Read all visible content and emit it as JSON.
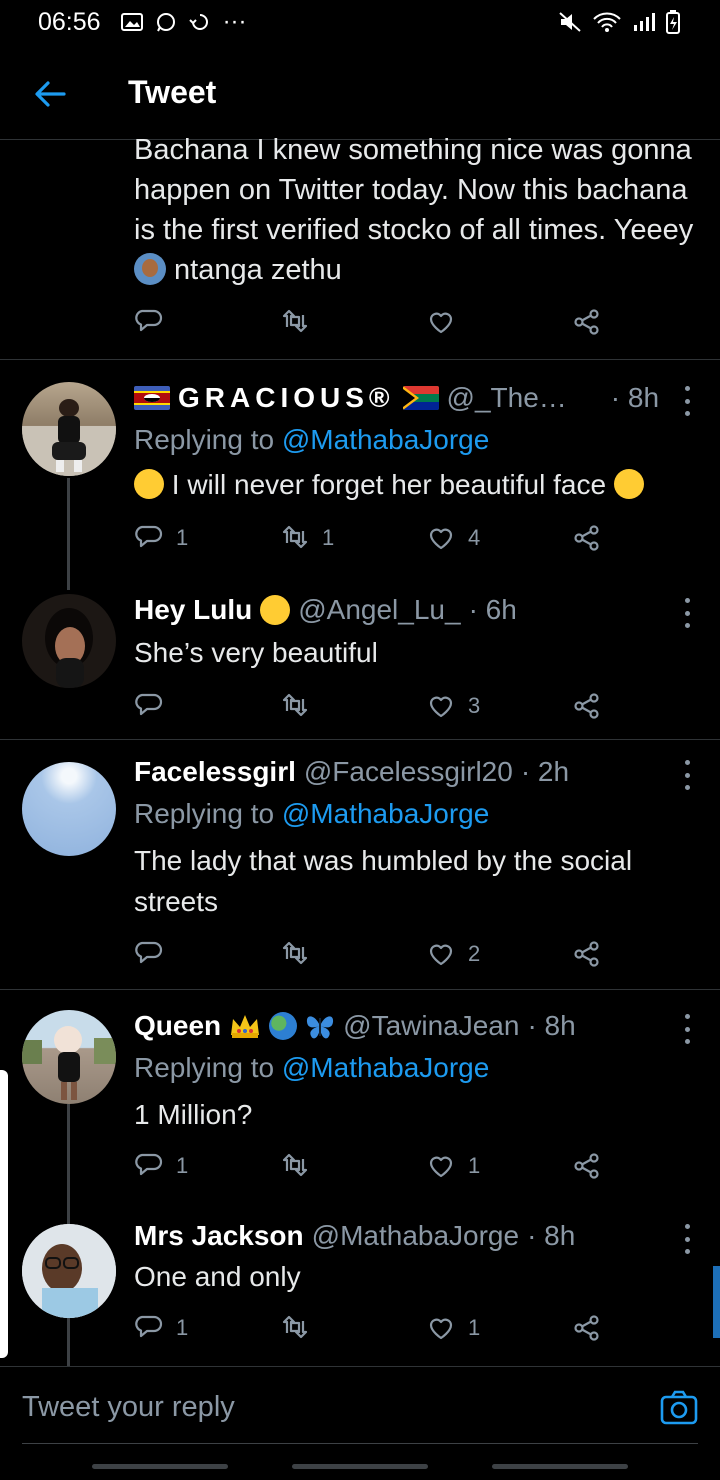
{
  "status_bar": {
    "time": "06:56",
    "more": "···"
  },
  "app_bar": {
    "title": "Tweet"
  },
  "main_tweet": {
    "text_1": "Bachana I knew something nice was gonna happen on Twitter today. Now this bachana is the first verified stocko of all times. Yeeey",
    "text_2": " ntanga zethu"
  },
  "replies": [
    {
      "name": "GRACIOUS®",
      "handle": "@_The…",
      "time": "· 8h",
      "replying_prefix": "Replying to ",
      "replying_to": "@MathabaJorge",
      "text": " I will never forget her beautiful face ",
      "reply_count": "1",
      "retweet_count": "1",
      "like_count": "4"
    },
    {
      "name": "Hey Lulu",
      "handle": "@Angel_Lu_",
      "time": "· 6h",
      "text": "She’s very beautiful",
      "reply_count": "",
      "retweet_count": "",
      "like_count": "3"
    },
    {
      "name": "Facelessgirl",
      "handle": "@Facelessgirl20",
      "time": "· 2h",
      "replying_prefix": "Replying to ",
      "replying_to": "@MathabaJorge",
      "text": "The lady that was humbled by the social streets",
      "reply_count": "",
      "retweet_count": "",
      "like_count": "2"
    },
    {
      "name": "Queen",
      "handle": "@TawinaJean",
      "time": "· 8h",
      "replying_prefix": "Replying to ",
      "replying_to": "@MathabaJorge",
      "text": "1 Million?",
      "reply_count": "1",
      "retweet_count": "",
      "like_count": "1"
    },
    {
      "name": "Mrs Jackson",
      "handle": "@MathabaJorge",
      "time": "· 8h",
      "text": "One and only",
      "reply_count": "1",
      "retweet_count": "",
      "like_count": "1"
    }
  ],
  "composer": {
    "placeholder": "Tweet your reply"
  },
  "colors": {
    "accent": "#1d9bf0",
    "muted": "#8b98a5",
    "divider": "#2f3336",
    "background": "#000000"
  },
  "icons": [
    "back-arrow-icon",
    "reply-icon",
    "retweet-icon",
    "like-icon",
    "share-icon",
    "more-icon",
    "camera-icon"
  ]
}
